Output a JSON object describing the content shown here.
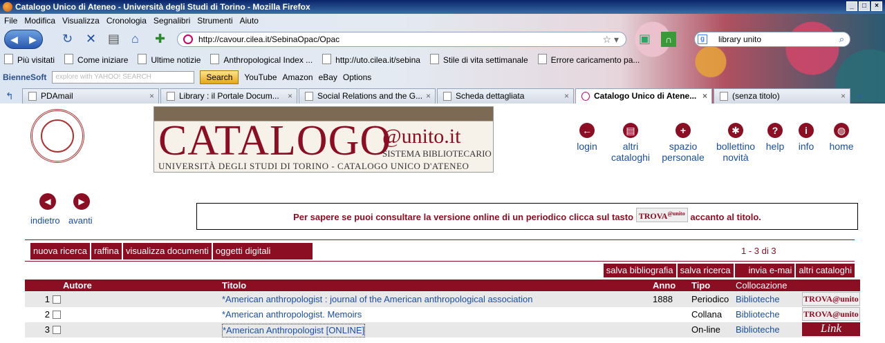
{
  "browser": {
    "window_title": "Catalogo Unico di Ateneo - Università degli Studi di Torino - Mozilla Firefox",
    "menu": [
      "File",
      "Modifica",
      "Visualizza",
      "Cronologia",
      "Segnalibri",
      "Strumenti",
      "Aiuto"
    ],
    "url": "http://cavour.cilea.it/SebinaOpac/Opac",
    "search_value": "library unito",
    "bookmarks": [
      "Più visitati",
      "Come iniziare",
      "Ultime notizie",
      "Anthropological Index ...",
      "http://uto.cilea.it/sebina",
      "Stile di vita settimanale",
      "Errore caricamento pa..."
    ],
    "toolbar": {
      "brand": "BienneSoft",
      "yahoo_placeholder": "explore with YAHOO! SEARCH",
      "search_button": "Search",
      "youtube": "YouTube",
      "amazon": "Amazon",
      "ebay": "eBay",
      "options": "Options"
    },
    "tabs": [
      {
        "label": "PDAmail",
        "active": false
      },
      {
        "label": "Library : il Portale Docum...",
        "active": false
      },
      {
        "label": "Social Relations and the G...",
        "active": false
      },
      {
        "label": "Scheda dettagliata",
        "active": false
      },
      {
        "label": "Catalogo Unico di Atene...",
        "active": true
      },
      {
        "label": "(senza titolo)",
        "active": false
      }
    ]
  },
  "header": {
    "banner_main": "CATALOGO",
    "banner_unito": "@unito.it",
    "banner_sistema": "SISTEMA BIBLIOTECARIO",
    "banner_university": "UNIVERSITÀ DEGLI STUDI DI TORINO - CATALOGO UNICO D'ATENEO",
    "nav": [
      {
        "line1": "login",
        "line2": ""
      },
      {
        "line1": "altri",
        "line2": "cataloghi"
      },
      {
        "line1": "spazio",
        "line2": "personale"
      },
      {
        "line1": "bollettino",
        "line2": "novità"
      },
      {
        "line1": "help",
        "line2": ""
      },
      {
        "line1": "info",
        "line2": ""
      },
      {
        "line1": "home",
        "line2": ""
      }
    ]
  },
  "history_nav": {
    "back": "indietro",
    "forward": "avanti"
  },
  "info": {
    "text_before": "Per sapere se puoi consultare la versione online di un periodico clicca sul tasto",
    "badge": "TROVA",
    "badge_sup": "@unito",
    "text_after": "accanto al titolo."
  },
  "actions": [
    "nuova ricerca",
    "raffina",
    "visualizza documenti",
    "oggetti digitali"
  ],
  "count": "1 - 3  di 3",
  "actions2": [
    "salva bibliografia",
    "salva ricerca",
    "invia e-mai",
    "altri cataloghi"
  ],
  "table": {
    "headers": {
      "autore": "Autore",
      "titolo": "Titolo",
      "anno": "Anno",
      "tipo": "Tipo",
      "collocazione": "Collocazione"
    },
    "rows": [
      {
        "num": "1",
        "title": "*American anthropologist : journal of the American anthropological association",
        "year": "1888",
        "type": "Periodico",
        "location": "Biblioteche",
        "badge": "TROVA@unito"
      },
      {
        "num": "2",
        "title": "*American anthropologist. Memoirs",
        "year": "",
        "type": "Collana",
        "location": "Biblioteche",
        "badge": "TROVA@unito"
      },
      {
        "num": "3",
        "title": "*American Anthropologist [ONLINE]",
        "year": "",
        "type": "On-line",
        "location": "Biblioteche",
        "badge": "Link"
      }
    ]
  }
}
